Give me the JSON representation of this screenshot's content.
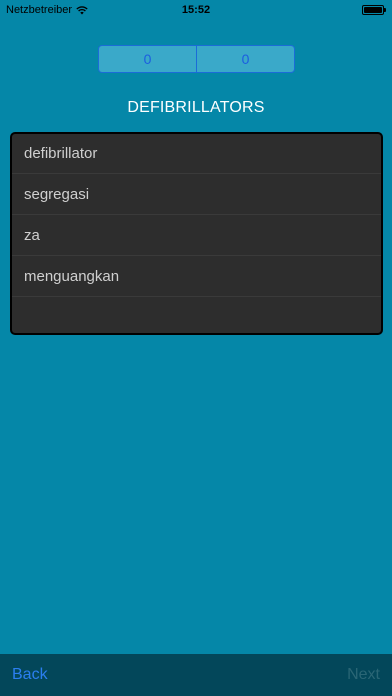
{
  "status_bar": {
    "carrier": "Netzbetreiber",
    "time": "15:52"
  },
  "scores": {
    "left": "0",
    "right": "0"
  },
  "question": {
    "word": "DEFIBRILLATORS"
  },
  "options": [
    "defibrillator",
    "segregasi",
    "za",
    "menguangkan"
  ],
  "toolbar": {
    "back_label": "Back",
    "next_label": "Next"
  },
  "colors": {
    "background": "#0587a8",
    "toolbar": "#03475a",
    "accent": "#2b7ff0"
  }
}
